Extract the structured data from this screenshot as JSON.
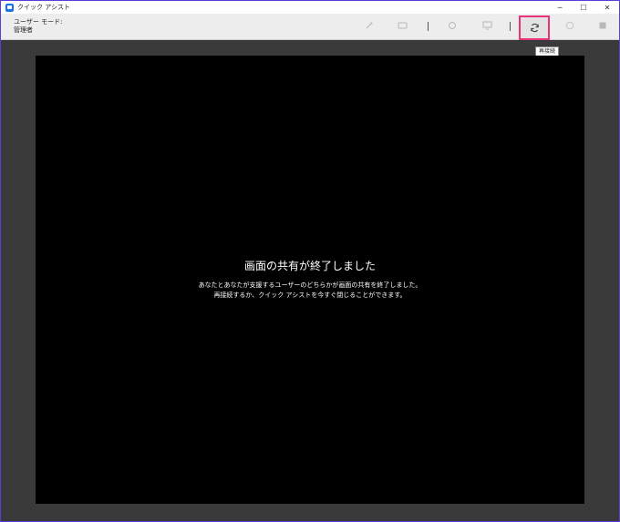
{
  "window": {
    "title": "クイック アシスト"
  },
  "window_controls": {
    "minimize": "─",
    "maximize": "☐",
    "close": "✕"
  },
  "toolbar": {
    "user_mode_label": "ユーザー モード:",
    "user_mode_value": "管理者"
  },
  "tooltip": {
    "text": "再接続"
  },
  "session": {
    "title": "画面の共有が終了しました",
    "line1": "あなたとあなたが支援するユーザーのどちらかが画面の共有を終了しました。",
    "line2": "再接続するか、クイック アシストを今すぐ閉じることができます。"
  },
  "colors": {
    "highlight": "#e8327a",
    "window_border": "#5a3fd6",
    "app_icon": "#1a73e8"
  }
}
